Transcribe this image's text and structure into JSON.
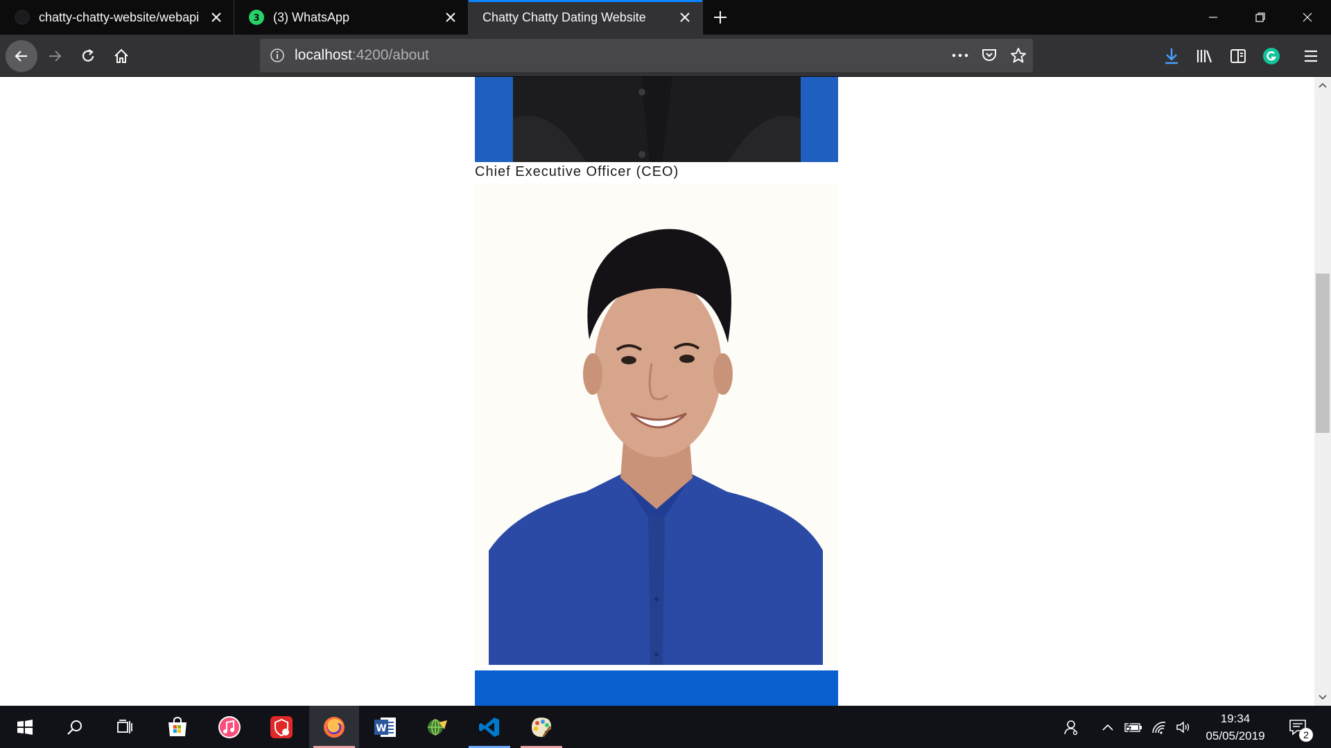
{
  "browser": {
    "tabs": [
      {
        "title": "chatty-chatty-website/webapi",
        "icon": "github-icon",
        "active": false
      },
      {
        "title": "(3) WhatsApp",
        "icon": "whatsapp-icon",
        "badge": "3",
        "active": false
      },
      {
        "title": "Chatty Chatty Dating Website",
        "icon": "",
        "active": true
      }
    ],
    "url_host": "localhost",
    "url_path": ":4200/about"
  },
  "page": {
    "caption": "Chief Executive Officer (CEO)"
  },
  "taskbar": {
    "time": "19:34",
    "date": "05/05/2019",
    "notification_count": "2",
    "apps": [
      "windows-start-icon",
      "search-icon",
      "task-view-icon",
      "microsoft-store-icon",
      "itunes-icon",
      "security-shield-icon",
      "firefox-icon",
      "word-icon",
      "globe-app-icon",
      "vscode-icon",
      "paint-icon"
    ]
  },
  "colors": {
    "tab_accent": "#0a84ff",
    "chrome_dark": "#0c0c0d",
    "toolbar": "#323234",
    "photo_blue": "#1e5fbf",
    "download_blue": "#45a1ff",
    "grammarly_green": "#15c39a"
  }
}
